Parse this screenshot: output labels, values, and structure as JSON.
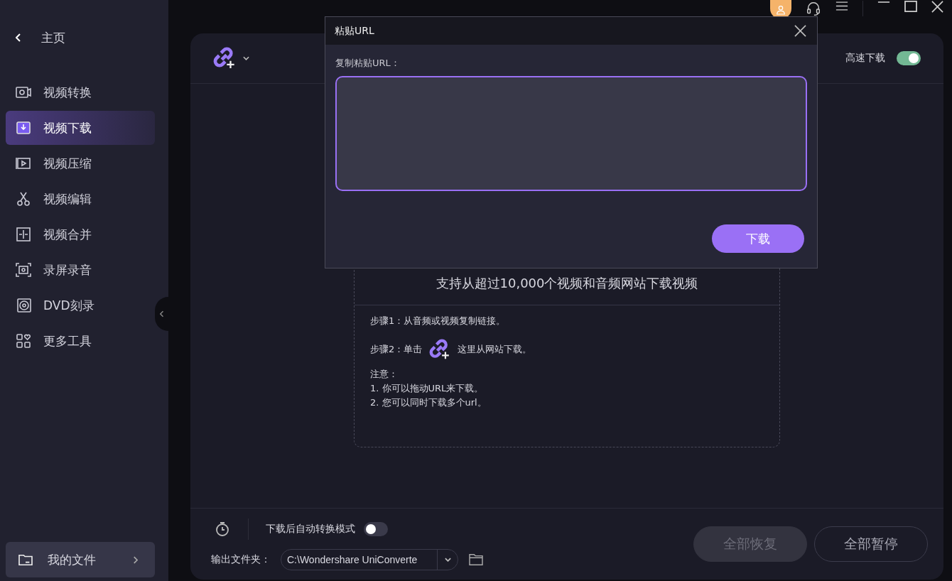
{
  "sidebar": {
    "home": "主页",
    "items": [
      {
        "label": "视频转换",
        "selected": false
      },
      {
        "label": "视频下载",
        "selected": true
      },
      {
        "label": "视频压缩",
        "selected": false
      },
      {
        "label": "视频编辑",
        "selected": false
      },
      {
        "label": "视频合并",
        "selected": false
      },
      {
        "label": "录屏录音",
        "selected": false
      },
      {
        "label": "DVD刻录",
        "selected": false
      },
      {
        "label": "更多工具",
        "selected": false
      }
    ],
    "my_files": "我的文件"
  },
  "toolbar": {
    "high_speed_label": "高速下载",
    "high_speed_on": true
  },
  "info": {
    "headline": "支持从超过10,000个视频和音频网站下载视频",
    "step1": "步骤1：从音频或视频复制链接。",
    "step2_before": "步骤2：单击",
    "step2_after": "这里从网站下载。",
    "note_title": "注意：",
    "notes": [
      "1. 你可以拖动URL来下载。",
      "2. 您可以同时下载多个url。"
    ]
  },
  "bottom": {
    "auto_convert_label": "下载后自动转换模式",
    "auto_convert_on": false,
    "output_label": "输出文件夹：",
    "output_path": "C:\\Wondershare UniConverte",
    "buttons": [
      {
        "label": "全部恢复",
        "disabled": true
      },
      {
        "label": "全部暂停",
        "disabled": false
      }
    ]
  },
  "dialog": {
    "title": "粘贴URL",
    "field_label": "复制粘贴URL：",
    "button": "下载"
  }
}
